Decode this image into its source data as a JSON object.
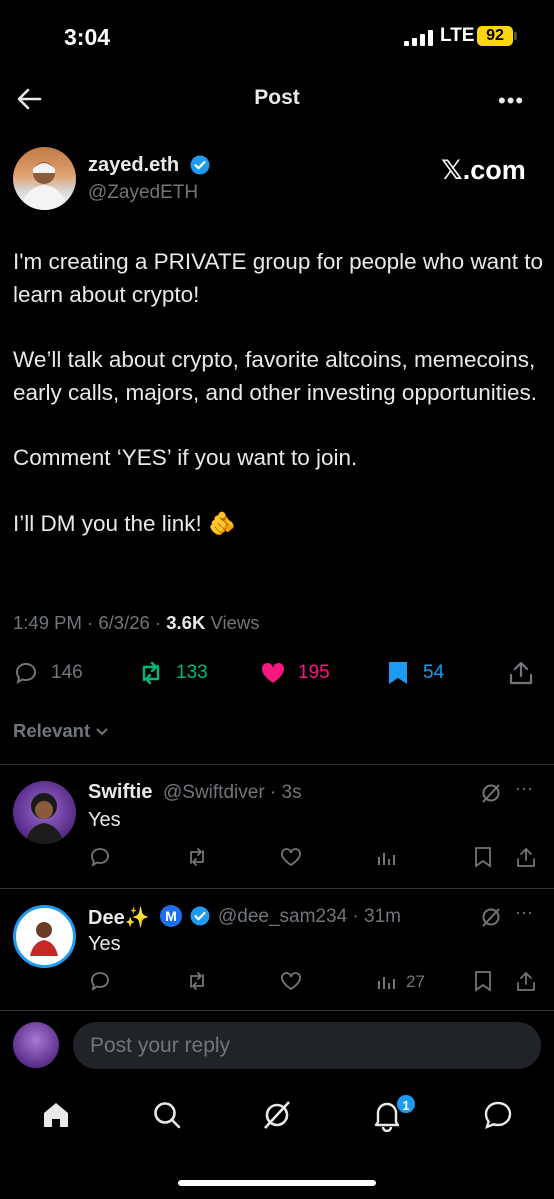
{
  "status_bar": {
    "time": "3:04",
    "network": "LTE",
    "battery": "92"
  },
  "header": {
    "title": "Post"
  },
  "author": {
    "name": "zayed.eth",
    "handle": "@ZayedETH",
    "source_label": "𝕏.com"
  },
  "post": {
    "paragraphs": [
      "I'm creating a PRIVATE group for people who want to learn about crypto!",
      "We’ll talk about crypto, favorite altcoins, memecoins, early calls, majors, and other investing opportunities.",
      "Comment ‘YES’ if you want to join.",
      "I’ll DM you the link! 🫵"
    ],
    "time": "1:49 PM",
    "date": "6/3/26",
    "views_count": "3.6K",
    "views_label": "Views"
  },
  "actions": {
    "replies": "146",
    "reposts": "133",
    "likes": "195",
    "bookmarks": "54"
  },
  "colors": {
    "repost": "#00ba7c",
    "like": "#f91880",
    "bookmark": "#1d9bf0",
    "muted": "#71767b"
  },
  "sort": {
    "label": "Relevant"
  },
  "replies": [
    {
      "name": "Swiftie",
      "handle": "@Swiftdiver",
      "time": "3s",
      "text": "Yes",
      "views": ""
    },
    {
      "name": "Dee✨",
      "badge": "M",
      "handle": "@dee_sam234",
      "time": "31m",
      "text": "Yes",
      "views": "27"
    }
  ],
  "compose": {
    "placeholder": "Post your reply"
  },
  "nav": {
    "notifications_badge": "1"
  }
}
